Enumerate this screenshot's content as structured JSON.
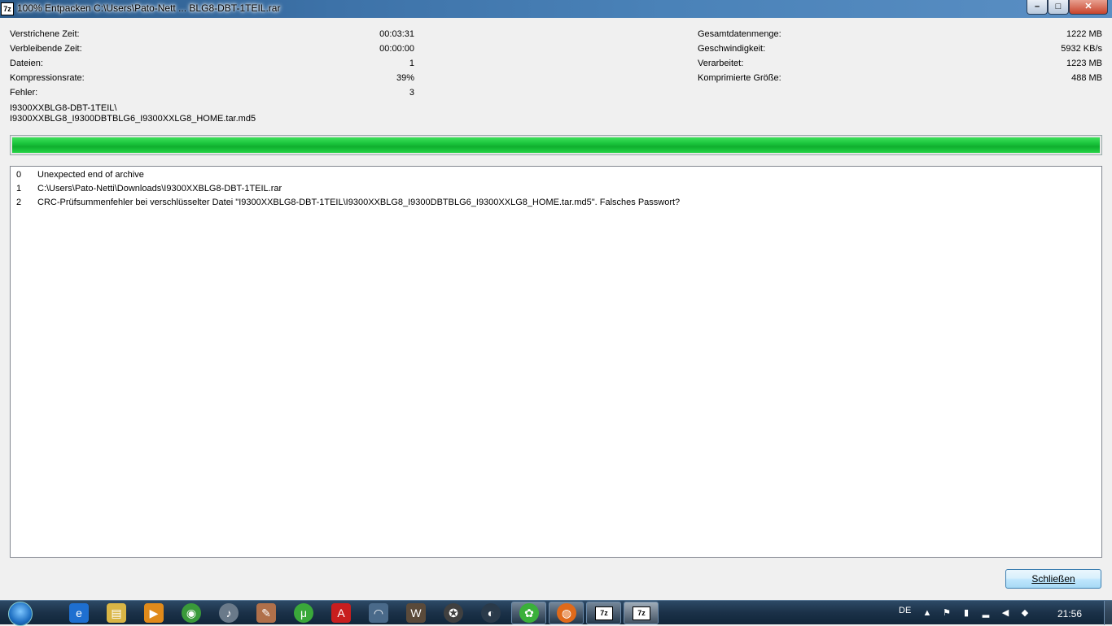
{
  "window": {
    "title": "100% Entpacken C:\\Users\\Pato-Nett ... BLG8-DBT-1TEIL.rar",
    "app_icon_text": "7z",
    "minimize_glyph": "–",
    "maximize_glyph": "□",
    "close_glyph": "✕"
  },
  "stats_left": [
    {
      "label": "Verstrichene Zeit:",
      "value": "00:03:31"
    },
    {
      "label": "Verbleibende Zeit:",
      "value": "00:00:00"
    },
    {
      "label": "Dateien:",
      "value": "1"
    },
    {
      "label": "Kompressionsrate:",
      "value": "39%"
    },
    {
      "label": "Fehler:",
      "value": "3"
    }
  ],
  "stats_right": [
    {
      "label": "Gesamtdatenmenge:",
      "value": "1222 MB"
    },
    {
      "label": "Geschwindigkeit:",
      "value": "5932 KB/s"
    },
    {
      "label": "Verarbeitet:",
      "value": "1223 MB"
    },
    {
      "label": "Komprimierte Größe:",
      "value": "488 MB"
    }
  ],
  "current_path": {
    "line1": "I9300XXBLG8-DBT-1TEIL\\",
    "line2": "I9300XXBLG8_I9300DBTBLG6_I9300XXLG8_HOME.tar.md5"
  },
  "progress": {
    "percent": 100,
    "color": "#1ac43c"
  },
  "log": [
    {
      "num": "0",
      "text": "Unexpected end of archive"
    },
    {
      "num": "1",
      "text": "C:\\Users\\Pato-Netti\\Downloads\\I9300XXBLG8-DBT-1TEIL.rar"
    },
    {
      "num": "2",
      "text": "CRC-Prüfsummenfehler bei verschlüsselter Datei \"I9300XXBLG8-DBT-1TEIL\\I9300XXBLG8_I9300DBTBLG6_I9300XXLG8_HOME.tar.md5\". Falsches Passwort?"
    }
  ],
  "close_button": {
    "label": "Schließen"
  },
  "taskbar": {
    "pinned_icons": [
      "internet-explorer-icon",
      "explorer-icon",
      "media-player-icon",
      "chrome-icon",
      "itunes-icon",
      "tool-icon",
      "utorrent-icon",
      "acrobat-icon",
      "game-icon",
      "world-of-tanks-icon",
      "counter-strike-icon",
      "steam-icon",
      "icq-icon",
      "firefox-icon"
    ],
    "task_7z_label": "7z",
    "language": "DE",
    "clock": "21:56"
  }
}
